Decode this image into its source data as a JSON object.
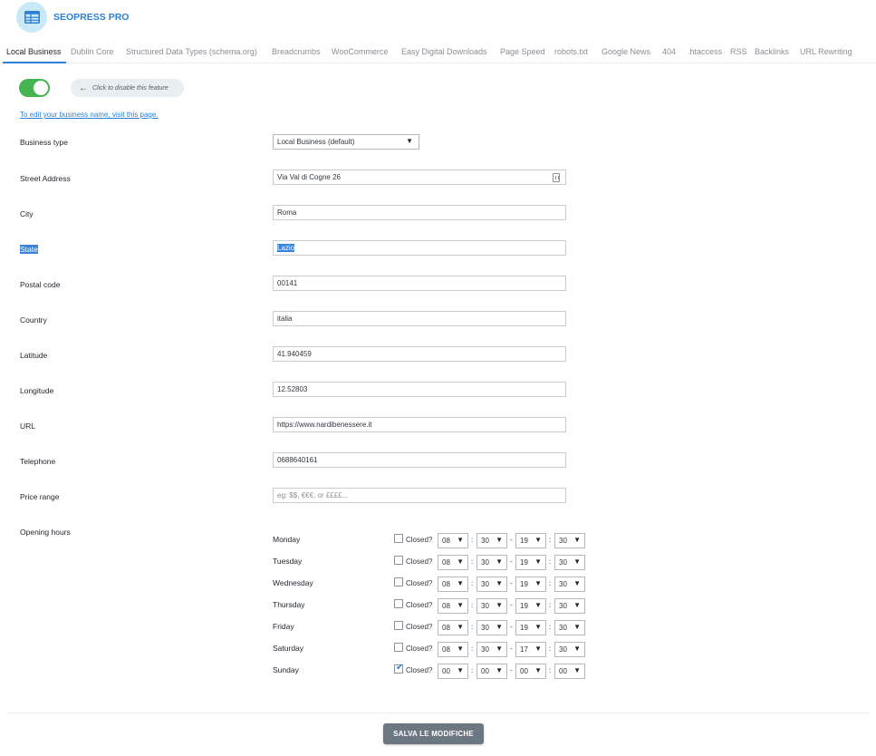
{
  "app": {
    "title": "SEOPRESS PRO",
    "logo_icon": "table-grid-icon",
    "accent_color": "#2a7fd6"
  },
  "tabs": [
    {
      "label": "Local Business",
      "active": true
    },
    {
      "label": "Dublin Core"
    },
    {
      "label": "Structured Data Types (schema.org)"
    },
    {
      "label": "Breadcrumbs"
    },
    {
      "label": "WooCommerce"
    },
    {
      "label": "Easy Digital Downloads"
    },
    {
      "label": "Page Speed"
    },
    {
      "label": "robots.txt"
    },
    {
      "label": "Google News"
    },
    {
      "label": "404"
    },
    {
      "label": ".htaccess"
    },
    {
      "label": "RSS"
    },
    {
      "label": "Backlinks"
    },
    {
      "label": "URL Rewriting"
    }
  ],
  "feature": {
    "enabled": true,
    "toggle_color": "#46b450",
    "hint": "Click to disable this feature",
    "hint_icon": "arrow-left-icon"
  },
  "edit_link": "To edit your business name, visit this page.",
  "fields": {
    "business_type": {
      "label": "Business type",
      "value": "Local Business (default)"
    },
    "street": {
      "label": "Street Address",
      "value": "Via Val di Cogne 26"
    },
    "city": {
      "label": "City",
      "value": "Roma"
    },
    "state": {
      "label": "State",
      "value": "Lazio"
    },
    "postal": {
      "label": "Postal code",
      "value": "00141"
    },
    "country": {
      "label": "Country",
      "value": "italia"
    },
    "latitude": {
      "label": "Latitude",
      "value": "41.940459"
    },
    "longitude": {
      "label": "Longitude",
      "value": "12.52803"
    },
    "url": {
      "label": "URL",
      "value": "https://www.nardibenessere.it"
    },
    "telephone": {
      "label": "Telephone",
      "value": "0688640161"
    },
    "price_range": {
      "label": "Price range",
      "value": "",
      "placeholder": "eg: $$, €€€, or ££££..."
    }
  },
  "opening_hours": {
    "label": "Opening hours",
    "closed_label": "Closed?",
    "days": [
      {
        "day": "Monday",
        "closed": false,
        "open_h": "08",
        "open_m": "30",
        "close_h": "19",
        "close_m": "30"
      },
      {
        "day": "Tuesday",
        "closed": false,
        "open_h": "08",
        "open_m": "30",
        "close_h": "19",
        "close_m": "30"
      },
      {
        "day": "Wednesday",
        "closed": false,
        "open_h": "08",
        "open_m": "30",
        "close_h": "19",
        "close_m": "30"
      },
      {
        "day": "Thursday",
        "closed": false,
        "open_h": "08",
        "open_m": "30",
        "close_h": "19",
        "close_m": "30"
      },
      {
        "day": "Friday",
        "closed": false,
        "open_h": "08",
        "open_m": "30",
        "close_h": "19",
        "close_m": "30"
      },
      {
        "day": "Saturday",
        "closed": false,
        "open_h": "08",
        "open_m": "30",
        "close_h": "17",
        "close_m": "30"
      },
      {
        "day": "Sunday",
        "closed": true,
        "open_h": "00",
        "open_m": "00",
        "close_h": "00",
        "close_m": "00"
      }
    ]
  },
  "save_button": "SALVA LE MODIFICHE"
}
